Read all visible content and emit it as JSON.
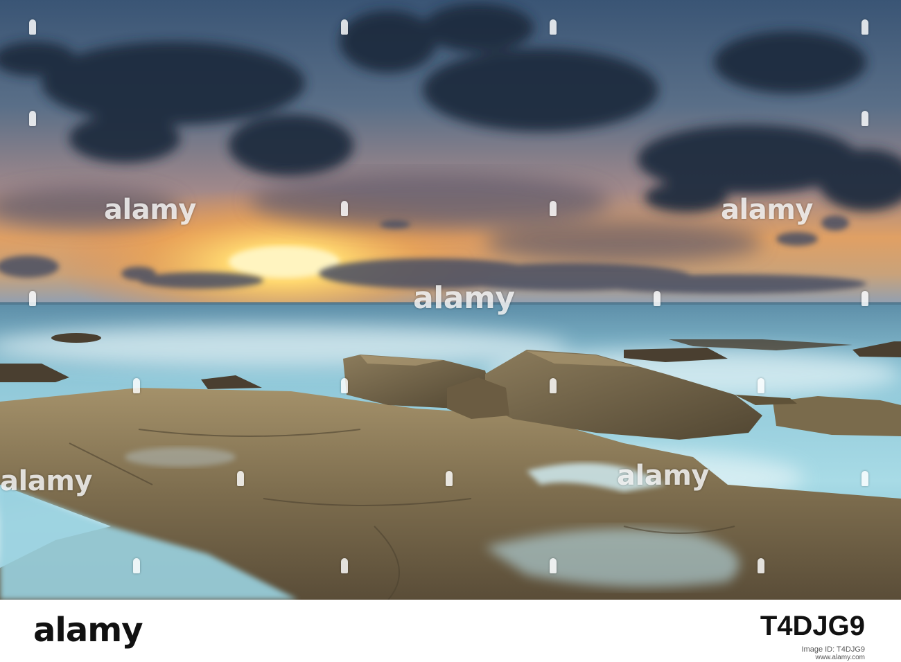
{
  "watermark": {
    "text": "alamy"
  },
  "footer": {
    "brand": "alamy",
    "image_id_label": "Image ID: T4DJG9",
    "image_id": "T4DJG9",
    "website": "www.alamy.com"
  },
  "colors": {
    "sky_top": "#3f5a78",
    "sun": "#ffe28a",
    "sea": "#7fc3d6",
    "rock": "#8a7a58",
    "cloud_dark": "#1f2a3c"
  }
}
